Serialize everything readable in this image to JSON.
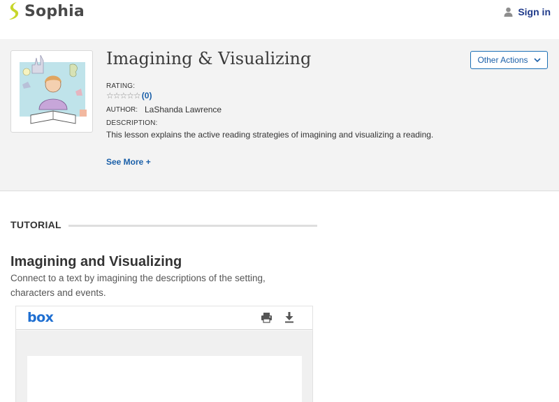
{
  "header": {
    "brand": "Sophia",
    "sign_in": "Sign in"
  },
  "lesson": {
    "title": "Imagining & Visualizing",
    "other_actions": "Other Actions",
    "rating_label": "RATING:",
    "rating_stars": "☆☆☆☆☆",
    "rating_count": "(0)",
    "author_label": "AUTHOR:",
    "author": "LaShanda Lawrence",
    "description_label": "DESCRIPTION:",
    "description": "This lesson explains the active reading strategies of imagining and visualizing a reading.",
    "see_more": "See More +"
  },
  "tutorial": {
    "heading": "TUTORIAL",
    "title": "Imagining and Visualizing",
    "description": "Connect to a text by imagining the descriptions of the setting, characters and events."
  },
  "embed": {
    "brand": "box"
  },
  "colors": {
    "brand_green": "#c7d62b",
    "link_blue": "#1a5fa8",
    "box_blue": "#1f6fd1",
    "band_bg": "#f3f3f3"
  }
}
